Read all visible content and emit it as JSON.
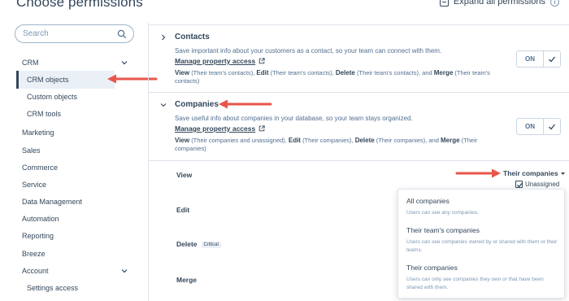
{
  "header": {
    "title": "Choose permissions",
    "expand_all_label": "Expand all permissions"
  },
  "search": {
    "placeholder": "Search"
  },
  "sidebar": {
    "items": [
      {
        "label": "CRM",
        "expandable": true
      },
      {
        "label": "CRM objects",
        "selected": true
      },
      {
        "label": "Custom objects"
      },
      {
        "label": "CRM tools"
      },
      {
        "label": "Marketing"
      },
      {
        "label": "Sales"
      },
      {
        "label": "Commerce"
      },
      {
        "label": "Service"
      },
      {
        "label": "Data Management"
      },
      {
        "label": "Automation"
      },
      {
        "label": "Reporting"
      },
      {
        "label": "Breeze"
      },
      {
        "label": "Account",
        "expandable": true
      },
      {
        "label": "Settings access"
      }
    ]
  },
  "sections": {
    "contacts": {
      "title": "Contacts",
      "description": "Save important info about your customers as a contact, so your team can connect with them.",
      "link": "Manage property access",
      "summary_view_label": "View",
      "summary_view_value": "(Their team's contacts),",
      "summary_edit_label": "Edit",
      "summary_edit_value": "(Their team's contacts),",
      "summary_delete_label": "Delete",
      "summary_delete_value": "(Their team's contacts), and",
      "summary_merge_label": "Merge",
      "summary_merge_value": "(Their team's contacts)",
      "toggle_label": "ON"
    },
    "companies": {
      "title": "Companies",
      "description": "Save useful info about companies in your database, so your team stays organized.",
      "link": "Manage property access",
      "summary_view_label": "View",
      "summary_view_value": "(Their companies and unassigned),",
      "summary_edit_label": "Edit",
      "summary_edit_value": "(Their companies),",
      "summary_delete_label": "Delete",
      "summary_delete_value": "(Their companies), and",
      "summary_merge_label": "Merge",
      "summary_merge_value": "(Their companies)",
      "toggle_label": "ON"
    }
  },
  "permissions": {
    "view": "View",
    "edit": "Edit",
    "delete": "Delete",
    "critical_badge": "Critical",
    "merge": "Merge",
    "view_selected": "Their companies",
    "unassigned_label": "Unassigned",
    "unassigned_checked": true
  },
  "dropdown": {
    "options": [
      {
        "title": "All companies",
        "desc": "Users can see any companies."
      },
      {
        "title": "Their team's companies",
        "desc": "Users can see companies owned by or shared with them or their teams."
      },
      {
        "title": "Their companies",
        "desc": "Users can only see companies they own or that have been shared with them."
      }
    ]
  },
  "colors": {
    "text": "#33475b",
    "muted": "#516f90",
    "border": "#dfe3eb",
    "annotation_arrow": "#e8564a",
    "selected_bg": "#eaf0f6"
  },
  "icons": {
    "search": "search-icon",
    "chevron_down": "chevron-down-icon",
    "chevron_right": "chevron-right-icon",
    "external_link": "external-link-icon",
    "check": "check-icon",
    "info": "info-icon",
    "caret_down": "caret-down-icon",
    "annotation_arrow": "arrow-left-icon"
  }
}
